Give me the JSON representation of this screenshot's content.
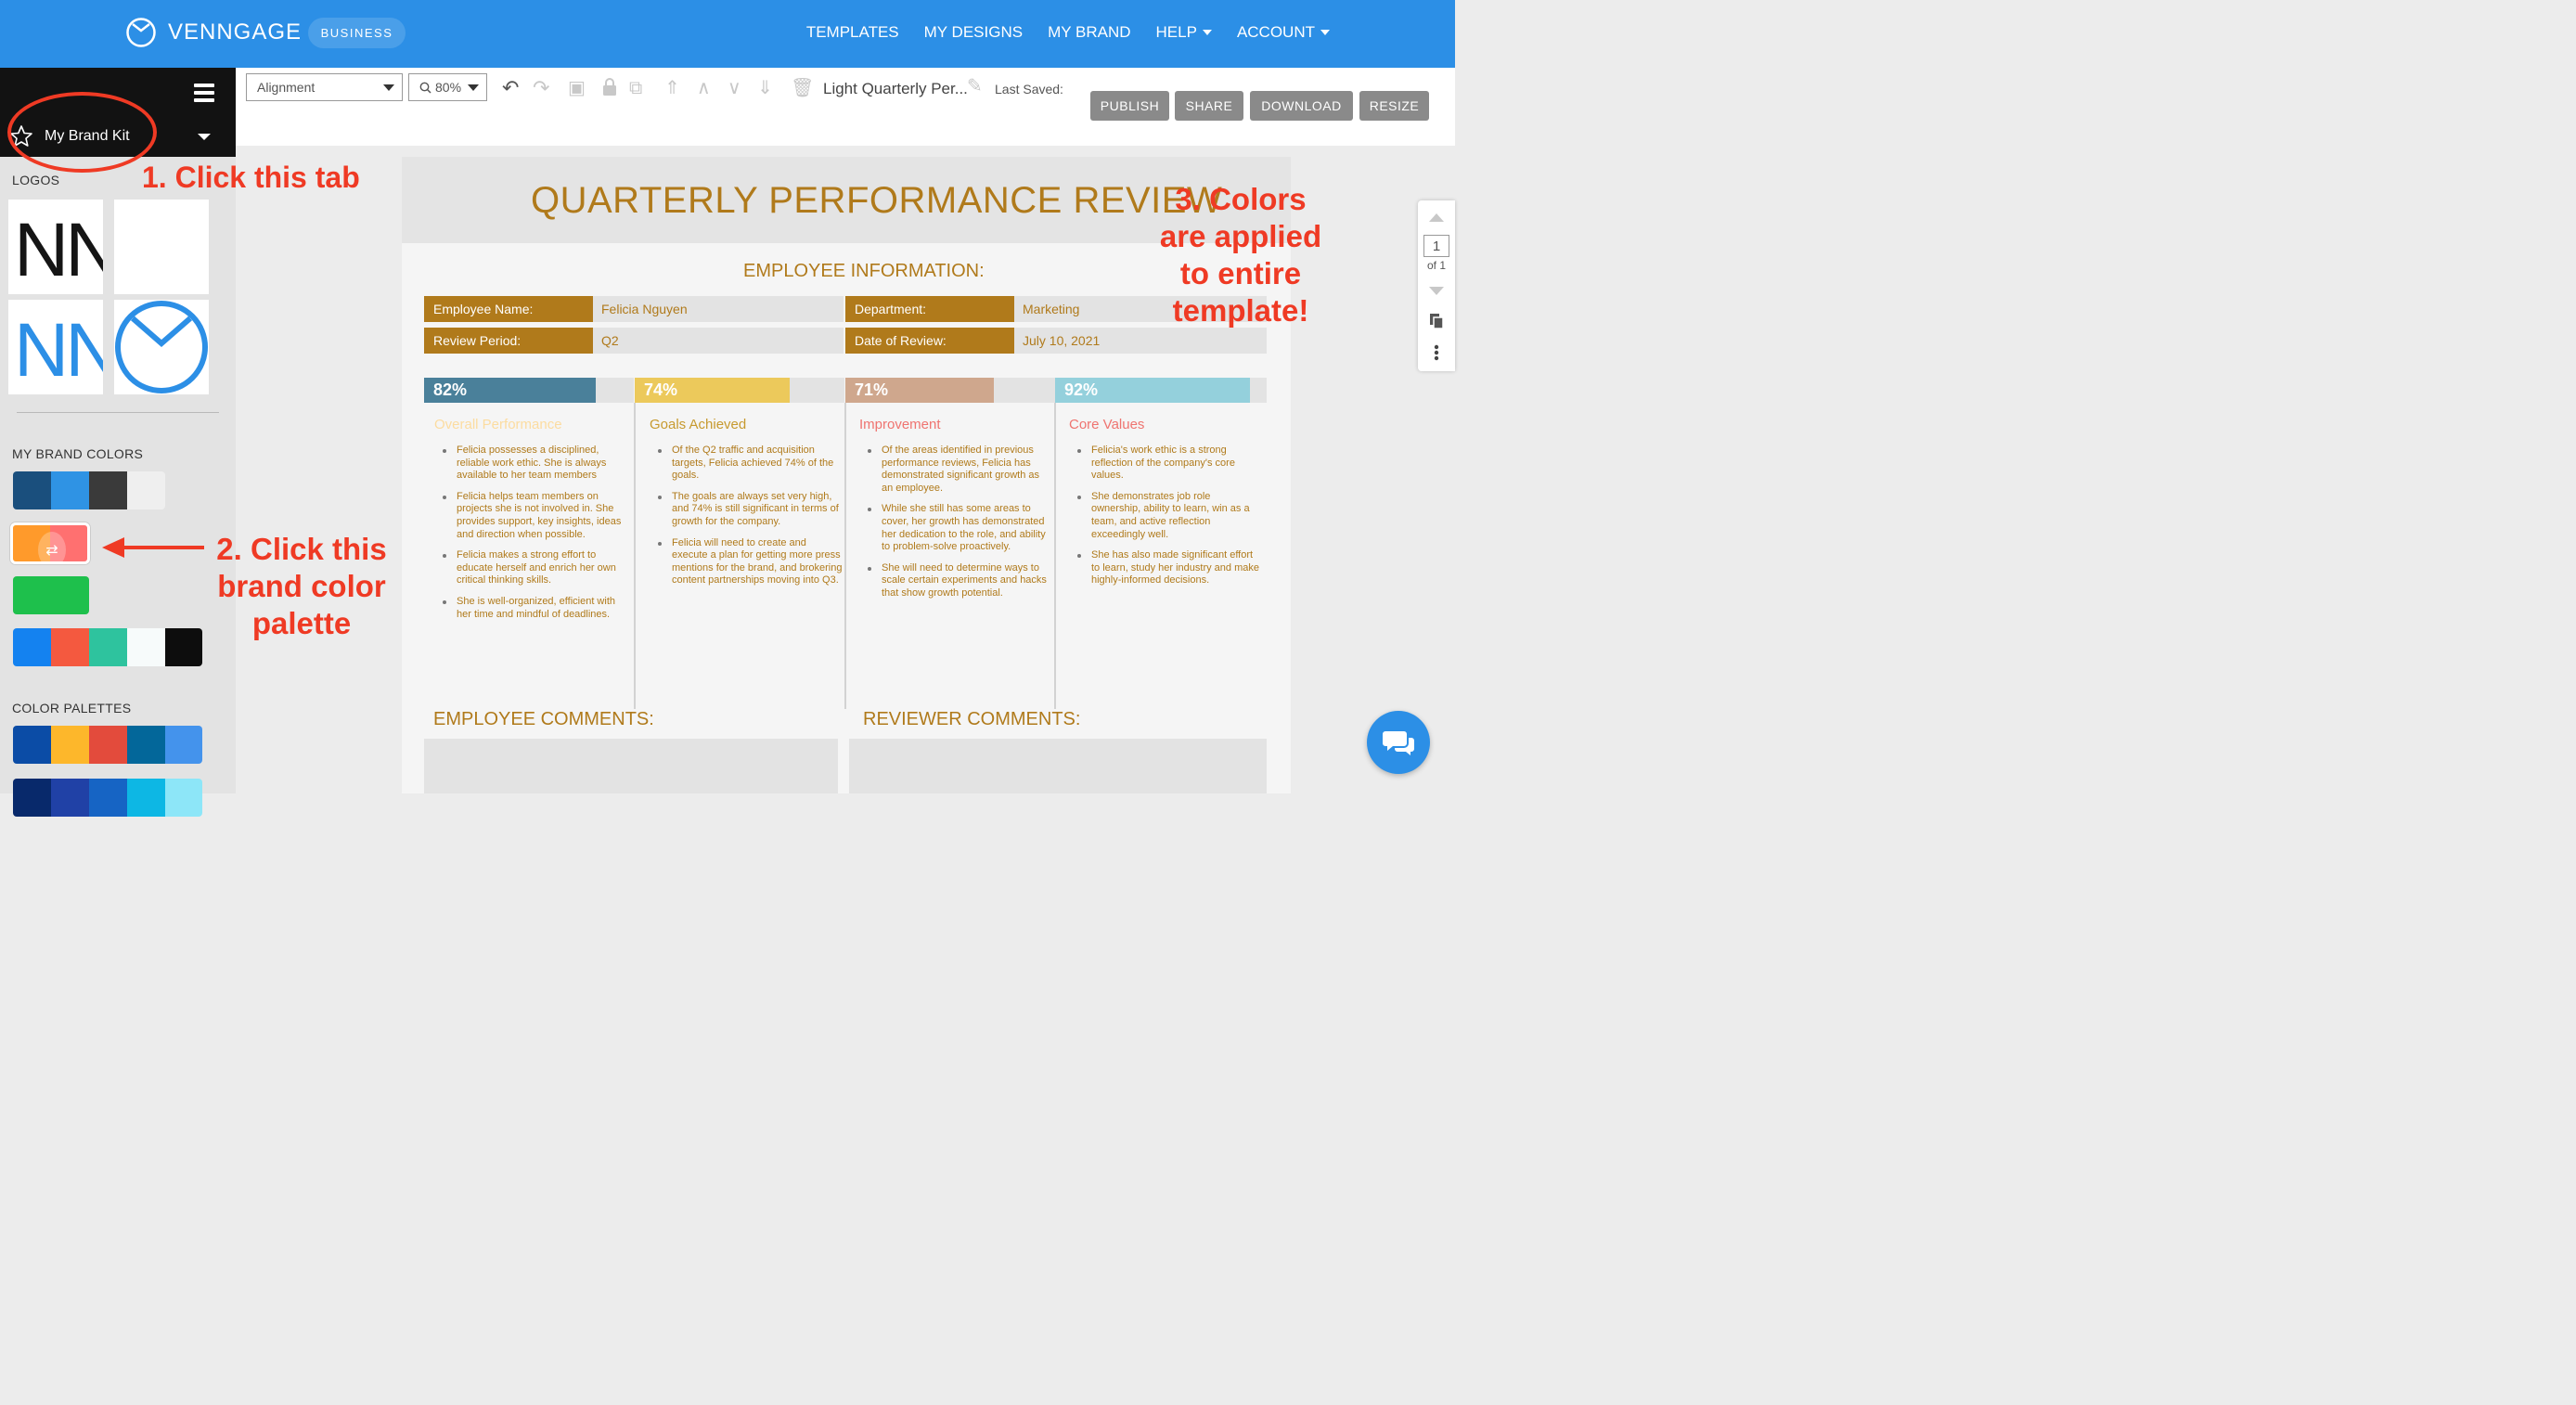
{
  "topbar": {
    "brand_name": "VENNGAGE",
    "badge": "BUSINESS",
    "nav": [
      {
        "label": "TEMPLATES",
        "caret": false
      },
      {
        "label": "MY DESIGNS",
        "caret": false
      },
      {
        "label": "MY BRAND",
        "caret": false
      },
      {
        "label": "HELP",
        "caret": true
      },
      {
        "label": "ACCOUNT",
        "caret": true
      }
    ],
    "color": "#2c8fe6"
  },
  "sidebar": {
    "kit_label": "My Brand Kit",
    "logos_heading": "LOGOS",
    "logo_text_black": "NN",
    "logo_text_blue": "NN",
    "brand_colors_heading": "MY BRAND COLORS",
    "brand_palettes": [
      [
        "#1a4f7d",
        "#2f93e4",
        "#3a3a3a",
        "#efefef"
      ],
      [
        "#ff9a2b",
        "#ff7070"
      ],
      [
        "#1ec04c"
      ],
      [
        "#1482f0",
        "#f4593f",
        "#2ec39e",
        "#f7fbfb",
        "#0d0d0d"
      ]
    ],
    "color_palettes_heading": "COLOR PALETTES",
    "color_palettes": [
      [
        "#0b4ca6",
        "#fdb72b",
        "#e34b3c",
        "#03679a",
        "#4493ec"
      ],
      [
        "#08296b",
        "#2041a6",
        "#1664c4",
        "#0db7e4",
        "#8de6f8"
      ]
    ]
  },
  "toolbar": {
    "alignment": "Alignment",
    "zoom": "80%",
    "doc_name": "Light Quarterly Per...",
    "last_saved": "Last Saved:",
    "buttons": [
      "PUBLISH",
      "SHARE",
      "DOWNLOAD",
      "RESIZE"
    ]
  },
  "template": {
    "title": "QUARTERLY PERFORMANCE REVIEW",
    "info_heading": "EMPLOYEE INFORMATION:",
    "fields": [
      {
        "label": "Employee Name:",
        "value": "Felicia Nguyen"
      },
      {
        "label": "Department:",
        "value": "Marketing"
      },
      {
        "label": "Review Period:",
        "value": "Q2"
      },
      {
        "label": "Date of Review:",
        "value": "July 10, 2021"
      }
    ],
    "metrics": [
      {
        "percent": "82%",
        "fraction": 0.82,
        "color": "#4a809a",
        "heading": "Overall Performance",
        "heading_color": "#fcdca0",
        "bullets": [
          "Felicia possesses a disciplined, reliable work ethic. She is always available to her team members",
          "Felicia helps team members on projects she is not involved in. She provides support, key insights, ideas and direction when possible.",
          "Felicia makes a strong effort to educate herself and enrich her own critical thinking skills.",
          "She is well-organized, efficient with her time and mindful of deadlines."
        ]
      },
      {
        "percent": "74%",
        "fraction": 0.74,
        "color": "#ecc95b",
        "heading": "Goals Achieved",
        "heading_color": "#c79a2f",
        "bullets": [
          "Of the Q2 traffic and acquisition targets, Felicia achieved 74% of the goals.",
          "The goals are always set very high, and 74% is still significant in terms of growth for the company.",
          "Felicia will need to create and execute a plan for getting more press mentions for the brand, and brokering content partnerships moving into Q3."
        ]
      },
      {
        "percent": "71%",
        "fraction": 0.71,
        "color": "#cfa78d",
        "heading": "Improvement",
        "heading_color": "#ef7470",
        "bullets": [
          "Of the areas identified in previous performance reviews, Felicia has demonstrated significant growth as an employee.",
          "While she still has some areas to cover, her growth has demonstrated her dedication to the role, and ability to problem-solve proactively.",
          "She will need to determine ways to scale certain experiments and hacks that show growth potential."
        ]
      },
      {
        "percent": "92%",
        "fraction": 0.92,
        "color": "#94d0dc",
        "heading": "Core Values",
        "heading_color": "#ef7470",
        "bullets": [
          "Felicia's work ethic is a strong reflection of the company's core values.",
          "She demonstrates job role ownership, ability to learn, win as a team, and active reflection exceedingly well.",
          "She has also made significant effort to learn, study her industry and make highly-informed decisions."
        ]
      }
    ],
    "employee_comments": "EMPLOYEE COMMENTS:",
    "reviewer_comments": "REVIEWER COMMENTS:"
  },
  "pager": {
    "page": "1",
    "of": "of 1"
  },
  "annotations": {
    "step1": "1. Click this tab",
    "step2": [
      "2. Click this",
      "brand color",
      "palette"
    ],
    "step3": [
      "3. Colors",
      "are applied",
      "to entire",
      "template!"
    ],
    "color": "#ef3a24"
  }
}
